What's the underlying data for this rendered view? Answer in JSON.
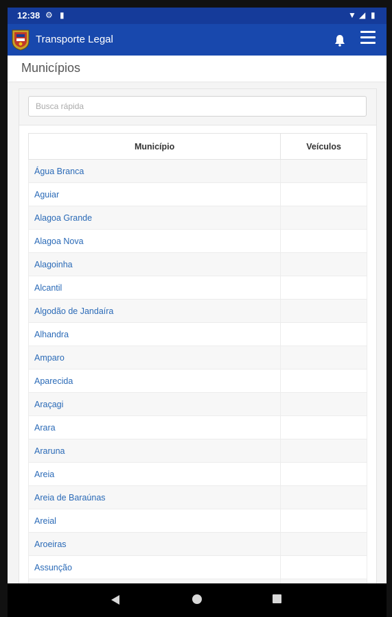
{
  "status_bar": {
    "time": "12:38",
    "left_icons": [
      "gear-icon",
      "sim-card-icon"
    ],
    "right_icons": [
      "wifi-icon",
      "signal-icon",
      "battery-icon"
    ]
  },
  "app_bar": {
    "title": "Transporte Legal",
    "color": "#1848ad",
    "icons": [
      "logo-crest-icon",
      "bell-icon",
      "hamburger-menu-icon"
    ]
  },
  "page": {
    "title": "Municípios"
  },
  "search": {
    "placeholder": "Busca rápida",
    "value": ""
  },
  "table": {
    "headers": [
      "Município",
      "Veículos"
    ],
    "rows": [
      {
        "municipio": "Água Branca",
        "veiculos": ""
      },
      {
        "municipio": "Aguiar",
        "veiculos": ""
      },
      {
        "municipio": "Alagoa Grande",
        "veiculos": ""
      },
      {
        "municipio": "Alagoa Nova",
        "veiculos": ""
      },
      {
        "municipio": "Alagoinha",
        "veiculos": ""
      },
      {
        "municipio": "Alcantil",
        "veiculos": ""
      },
      {
        "municipio": "Algodão de Jandaíra",
        "veiculos": ""
      },
      {
        "municipio": "Alhandra",
        "veiculos": ""
      },
      {
        "municipio": "Amparo",
        "veiculos": ""
      },
      {
        "municipio": "Aparecida",
        "veiculos": ""
      },
      {
        "municipio": "Araçagi",
        "veiculos": ""
      },
      {
        "municipio": "Arara",
        "veiculos": ""
      },
      {
        "municipio": "Araruna",
        "veiculos": ""
      },
      {
        "municipio": "Areia",
        "veiculos": ""
      },
      {
        "municipio": "Areia de Baraúnas",
        "veiculos": ""
      },
      {
        "municipio": "Areial",
        "veiculos": ""
      },
      {
        "municipio": "Aroeiras",
        "veiculos": ""
      },
      {
        "municipio": "Assunção",
        "veiculos": ""
      },
      {
        "municipio": "",
        "veiculos": ""
      }
    ]
  },
  "nav_bar": {
    "icons": [
      "back-triangle-icon",
      "home-circle-icon",
      "recents-square-icon"
    ]
  }
}
